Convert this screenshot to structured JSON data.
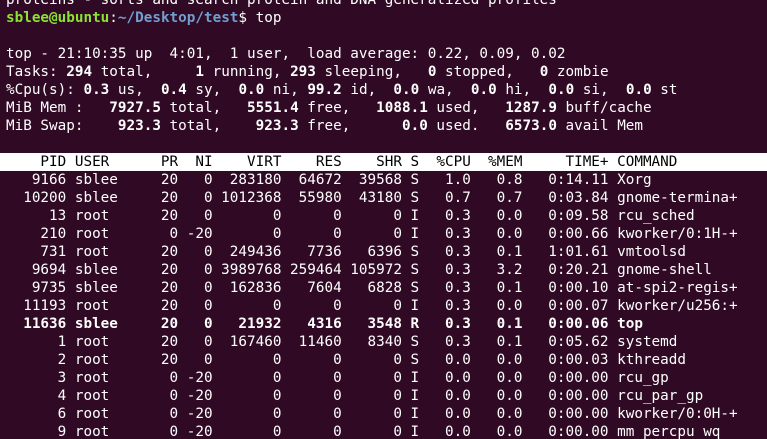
{
  "terminal": {
    "previous_line": "proteins - sorts and search protein and DNA generalized profiles",
    "prompt_user_host": "sblee@ubuntu",
    "prompt_sep": ":",
    "prompt_path": "~/Desktop/test",
    "prompt_symbol": "$ ",
    "command": "top"
  },
  "top_summary": {
    "uptime_line": "top - 21:10:35 up  4:01,  1 user,  load average: 0.22, 0.09, 0.02",
    "tasks": {
      "label": "Tasks: ",
      "total": "294",
      "total_label": " total,   ",
      "running": "  1",
      "running_label": " running, ",
      "sleeping": "293",
      "sleeping_label": " sleeping,   ",
      "stopped": "0",
      "stopped_label": " stopped,   ",
      "zombie": "0",
      "zombie_label": " zombie"
    },
    "cpu": {
      "label": "%Cpu(s): ",
      "us": "0.3",
      "us_label": " us,  ",
      "sy": "0.4",
      "sy_label": " sy,  ",
      "ni": "0.0",
      "ni_label": " ni, ",
      "id": "99.2",
      "id_label": " id,  ",
      "wa": "0.0",
      "wa_label": " wa,  ",
      "hi": "0.0",
      "hi_label": " hi,  ",
      "si": "0.0",
      "si_label": " si,  ",
      "st": "0.0",
      "st_label": " st"
    },
    "mem": {
      "label": "MiB Mem :   ",
      "total": "7927.5",
      "total_label": " total,   ",
      "free": "5551.4",
      "free_label": " free,   ",
      "used": "1088.1",
      "used_label": " used,   ",
      "buff": "1287.9",
      "buff_label": " buff/cache"
    },
    "swap": {
      "label": "MiB Swap:    ",
      "total": "923.3",
      "total_label": " total,    ",
      "free": "923.3",
      "free_label": " free,      ",
      "used": "0.0",
      "used_label": " used.   ",
      "avail": "6573.0",
      "avail_label": " avail Mem"
    }
  },
  "process_table": {
    "header": "    PID USER      PR  NI    VIRT    RES    SHR S  %CPU  %MEM     TIME+ COMMAND",
    "rows": [
      "   9166 sblee     20   0  283180  64672  39568 S   1.0   0.8   0:14.11 Xorg",
      "  10200 sblee     20   0 1012368  55980  43180 S   0.7   0.7   0:03.84 gnome-termina+",
      "     13 root      20   0       0      0      0 I   0.3   0.0   0:09.58 rcu_sched",
      "    210 root       0 -20       0      0      0 I   0.3   0.0   0:00.66 kworker/0:1H-+",
      "    731 root      20   0  249436   7736   6396 S   0.3   0.1   1:01.61 vmtoolsd",
      "   9694 sblee     20   0 3989768 259464 105972 S   0.3   3.2   0:20.21 gnome-shell",
      "   9735 sblee     20   0  162836   7604   6828 S   0.3   0.1   0:00.10 at-spi2-regis+",
      "  11193 root      20   0       0      0      0 I   0.3   0.0   0:00.07 kworker/u256:+",
      "  11636 sblee     20   0   21932   4316   3548 R   0.3   0.1   0:00.06 top",
      "      1 root      20   0  167460  11460   8340 S   0.3   0.1   0:05.62 systemd",
      "      2 root      20   0       0      0      0 S   0.0   0.0   0:00.03 kthreadd",
      "      3 root       0 -20       0      0      0 I   0.0   0.0   0:00.00 rcu_gp",
      "      4 root       0 -20       0      0      0 I   0.0   0.0   0:00.00 rcu_par_gp",
      "      6 root       0 -20       0      0      0 I   0.0   0.0   0:00.00 kworker/0:0H-+",
      "      9 root       0 -20       0      0      0 I   0.0   0.0   0:00.00 mm_percpu_wq"
    ]
  }
}
